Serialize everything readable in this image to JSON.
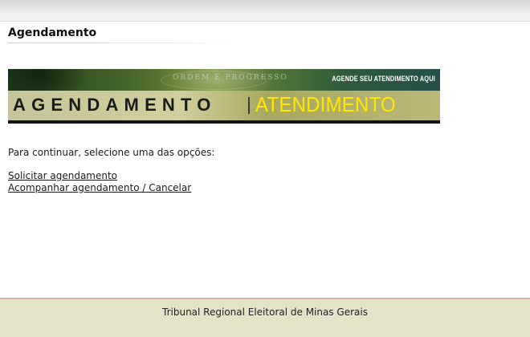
{
  "page": {
    "title": "Agendamento"
  },
  "banner": {
    "tagline": "AGENDE SEU ATENDIMENTO AQUI",
    "word_left": "AGENDAMENTO",
    "word_right": "ATENDIMENTO",
    "seal_text": "ORDEM E PROGRESSO",
    "colors": {
      "accent_yellow": "#ffe800",
      "dark_green": "#1f3a1c",
      "khaki": "#c6c49b"
    }
  },
  "main": {
    "instruction": "Para continuar, selecione uma das opções:",
    "links": [
      {
        "label": "Solicitar agendamento"
      },
      {
        "label": "Acompanhar agendamento / Cancelar"
      }
    ]
  },
  "footer": {
    "text": "Tribunal Regional Eleitoral de Minas Gerais"
  }
}
